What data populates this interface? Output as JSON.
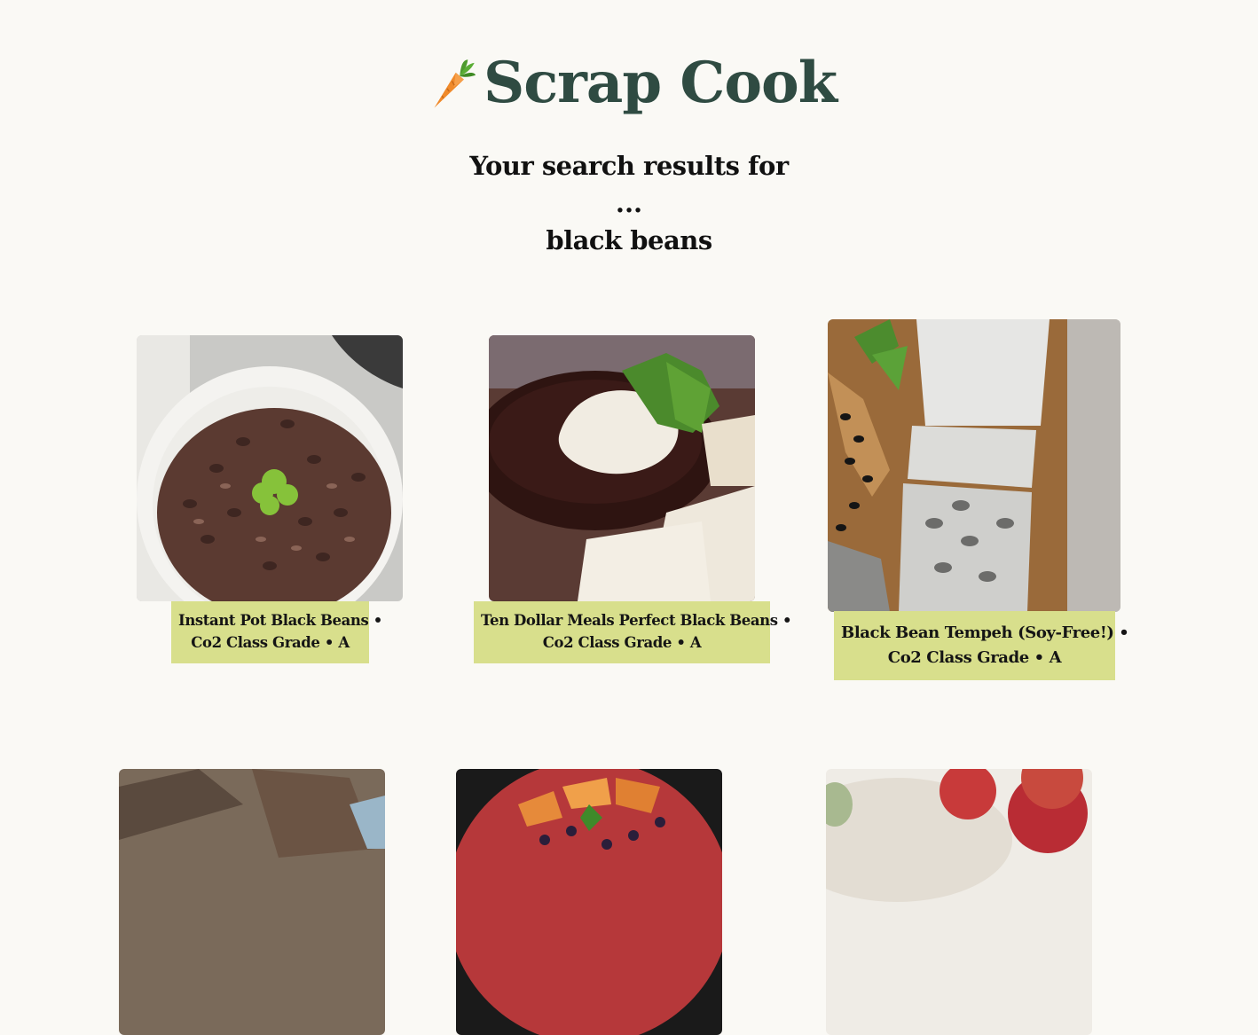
{
  "brand": {
    "name": "Scrap Cook",
    "logo_icon": "carrot-icon"
  },
  "search": {
    "heading": "Your search results for",
    "separator": "...",
    "query": "black beans"
  },
  "results": [
    {
      "title": "Instant Pot Black Beans •",
      "grade": "Co2 Class Grade • A",
      "image": "bowl-of-black-beans"
    },
    {
      "title": "Ten Dollar Meals Perfect Black Beans •",
      "grade": "Co2 Class Grade • A",
      "image": "black-bean-soup-with-sour-cream"
    },
    {
      "title": "Black Bean Tempeh (Soy-Free!) •",
      "grade": "Co2 Class Grade • A",
      "image": "black-bean-tempeh-on-board"
    },
    {
      "title": "",
      "grade": "",
      "image": "black-bean-bread"
    },
    {
      "title": "",
      "grade": "",
      "image": "sweet-potato-black-bean-plate"
    },
    {
      "title": "",
      "grade": "",
      "image": "peaches-and-cream"
    }
  ],
  "colors": {
    "brand": "#2f4b42",
    "caption_bg": "#d8df8c",
    "page_bg": "#faf9f5"
  }
}
